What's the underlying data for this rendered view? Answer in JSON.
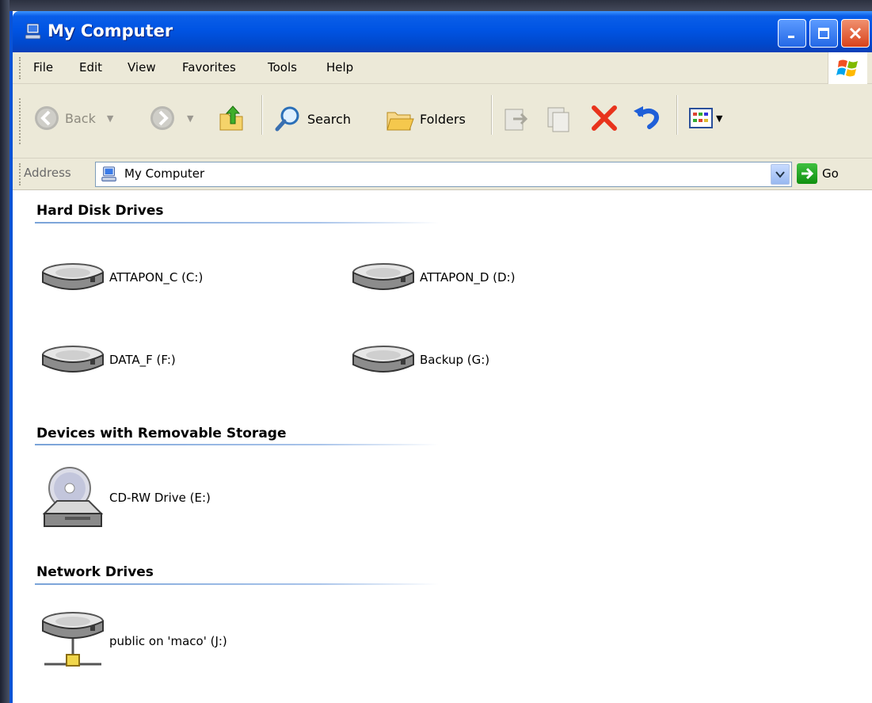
{
  "window": {
    "title": "My Computer",
    "icon": "computer-icon"
  },
  "menubar": {
    "items": [
      "File",
      "Edit",
      "View",
      "Favorites",
      "Tools",
      "Help"
    ]
  },
  "toolbar": {
    "back_label": "Back",
    "search_label": "Search",
    "folders_label": "Folders"
  },
  "address": {
    "label": "Address",
    "value": "My Computer",
    "go_label": "Go"
  },
  "groups": [
    {
      "title": "Hard Disk Drives",
      "items": [
        {
          "label": "ATTAPON_C (C:)",
          "icon": "hard-disk-icon"
        },
        {
          "label": "ATTAPON_D (D:)",
          "icon": "hard-disk-icon"
        },
        {
          "label": "DATA_F (F:)",
          "icon": "hard-disk-icon"
        },
        {
          "label": "Backup (G:)",
          "icon": "hard-disk-icon"
        }
      ]
    },
    {
      "title": "Devices with Removable Storage",
      "items": [
        {
          "label": "CD-RW Drive (E:)",
          "icon": "cd-drive-icon"
        }
      ]
    },
    {
      "title": "Network Drives",
      "items": [
        {
          "label": "public on 'maco' (J:)",
          "icon": "network-drive-icon"
        }
      ]
    }
  ],
  "colors": {
    "titlebar": "#0054e3",
    "chrome": "#ece9d8",
    "close_button": "#d8431c",
    "group_line": "#7aa3d8"
  }
}
